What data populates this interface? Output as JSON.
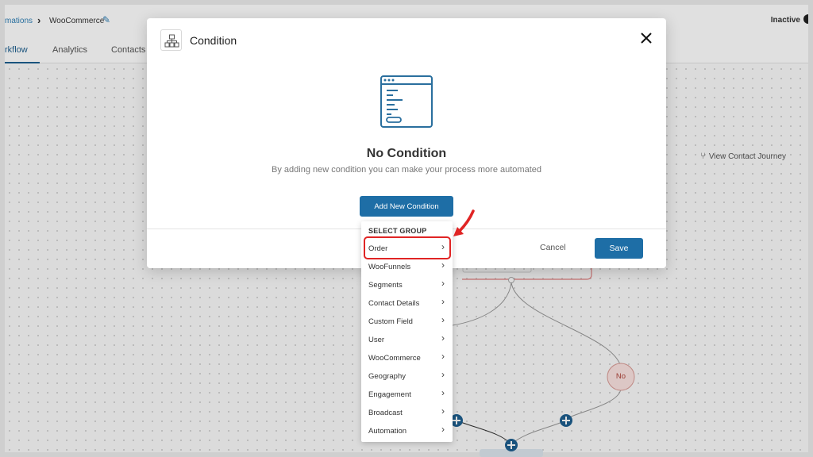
{
  "header": {
    "breadcrumb_root": "mations",
    "breadcrumb_current": "WooCommerce",
    "status_label": "Inactive"
  },
  "tabs": [
    {
      "label": "rkflow"
    },
    {
      "label": "Analytics"
    },
    {
      "label": "Contacts"
    }
  ],
  "canvas": {
    "view_journey_label": "View Contact Journey",
    "no_branch_label": "No"
  },
  "modal": {
    "title": "Condition",
    "empty_title": "No Condition",
    "empty_description": "By adding new condition you can make your process more automated",
    "add_button_label": "Add New Condition",
    "cancel_label": "Cancel",
    "save_label": "Save"
  },
  "dropdown": {
    "header": "SELECT GROUP",
    "items": [
      {
        "label": "Order"
      },
      {
        "label": "WooFunnels"
      },
      {
        "label": "Segments"
      },
      {
        "label": "Contact Details"
      },
      {
        "label": "Custom Field"
      },
      {
        "label": "User"
      },
      {
        "label": "WooCommerce"
      },
      {
        "label": "Geography"
      },
      {
        "label": "Engagement"
      },
      {
        "label": "Broadcast"
      },
      {
        "label": "Automation"
      }
    ],
    "highlighted": "Order"
  },
  "colors": {
    "primary": "#1e6ea6",
    "highlight": "#e02424",
    "no_branch": "#c45a50"
  }
}
